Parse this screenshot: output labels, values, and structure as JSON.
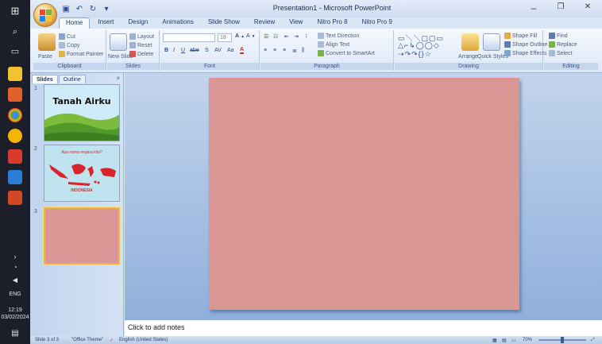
{
  "window": {
    "title": "Presentation1 - Microsoft PowerPoint",
    "minimize": "–",
    "maximize": "❐",
    "close": "✕"
  },
  "ribbon_tabs": [
    "Home",
    "Insert",
    "Design",
    "Animations",
    "Slide Show",
    "Review",
    "View",
    "Nitro Pro 8",
    "Nitro Pro 9"
  ],
  "ribbon": {
    "clipboard": {
      "label": "Clipboard",
      "paste": "Paste",
      "cut": "Cut",
      "copy": "Copy",
      "format_painter": "Format Painter"
    },
    "slides": {
      "label": "Slides",
      "new_slide": "New Slide",
      "layout": "Layout",
      "reset": "Reset",
      "delete": "Delete"
    },
    "font": {
      "label": "Font",
      "font_name": "",
      "font_size": "18"
    },
    "paragraph": {
      "label": "Paragraph",
      "text_direction": "Text Direction",
      "align_text": "Align Text",
      "convert_smartart": "Convert to SmartArt"
    },
    "drawing": {
      "label": "Drawing",
      "arrange": "Arrange",
      "quick_styles": "Quick Styles",
      "shape_fill": "Shape Fill",
      "shape_outline": "Shape Outline",
      "shape_effects": "Shape Effects"
    },
    "editing": {
      "label": "Editing",
      "find": "Find",
      "replace": "Replace",
      "select": "Select"
    }
  },
  "slides_pane": {
    "tabs": [
      "Slides",
      "Outline"
    ],
    "close": "×",
    "thumbnails": [
      {
        "number": "1",
        "title": "Tanah Airku"
      },
      {
        "number": "2",
        "title": "Apa nama negara kita?",
        "caption": "INDONESIA"
      },
      {
        "number": "3",
        "title": ""
      }
    ]
  },
  "notes": {
    "placeholder": "Click to add notes"
  },
  "status_bar": {
    "slide_info": "Slide 3 of 3",
    "theme": "\"Office Theme\"",
    "language": "English (United States)",
    "zoom": "70%"
  },
  "taskbar": {
    "time": "12:19",
    "date": "03/02/2024",
    "lang": "ENG"
  },
  "colors": {
    "slide_background": "#d99694",
    "ribbon_bg": "#dce8f7",
    "taskbar_bg": "#1c1f2a"
  }
}
